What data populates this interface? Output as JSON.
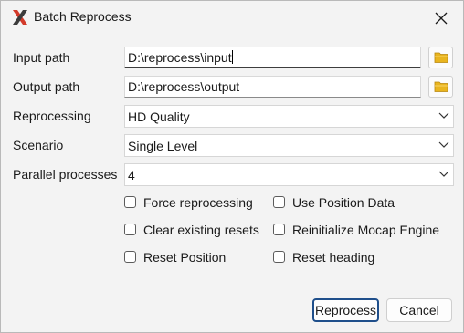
{
  "window": {
    "title": "Batch Reprocess"
  },
  "form": {
    "input_path": {
      "label": "Input path",
      "value": "D:\\reprocess\\input"
    },
    "output_path": {
      "label": "Output path",
      "value": "D:\\reprocess\\output"
    },
    "reprocessing": {
      "label": "Reprocessing",
      "selected": "HD Quality"
    },
    "scenario": {
      "label": "Scenario",
      "selected": "Single Level"
    },
    "parallel_processes": {
      "label": "Parallel processes",
      "selected": "4"
    }
  },
  "options": {
    "force_reprocessing": {
      "label": "Force reprocessing",
      "checked": false
    },
    "use_position_data": {
      "label": "Use Position Data",
      "checked": false
    },
    "clear_existing_resets": {
      "label": "Clear existing resets",
      "checked": false
    },
    "reinitialize_mocap_engine": {
      "label": "Reinitialize Mocap Engine",
      "checked": false
    },
    "reset_position": {
      "label": "Reset Position",
      "checked": false
    },
    "reset_heading": {
      "label": "Reset heading",
      "checked": false
    }
  },
  "buttons": {
    "reprocess": "Reprocess",
    "cancel": "Cancel"
  },
  "icons": {
    "app": "x-logo-icon",
    "close": "close-icon",
    "browse": "folder-icon",
    "dropdown": "chevron-down-icon"
  },
  "colors": {
    "app_icon": "#d23a2a",
    "folder": "#e9b51f",
    "primary_border": "#1f4f8b"
  }
}
